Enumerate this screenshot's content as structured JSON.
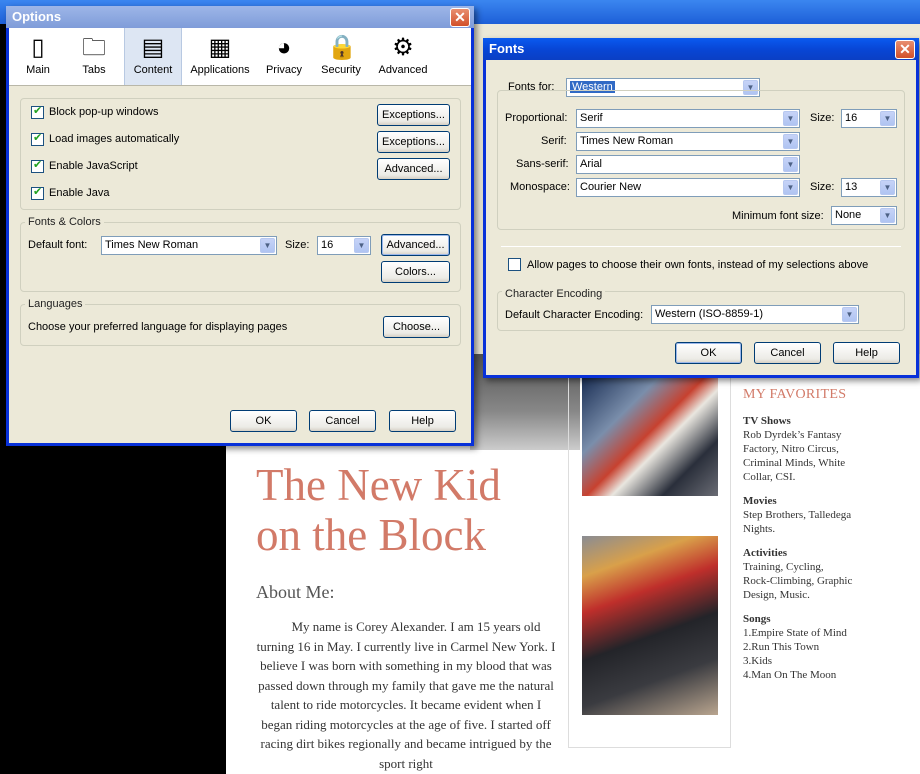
{
  "options_dialog": {
    "title": "Options",
    "tabs": [
      {
        "label": "Main",
        "icon": "main-icon"
      },
      {
        "label": "Tabs",
        "icon": "tabs-icon"
      },
      {
        "label": "Content",
        "icon": "content-icon"
      },
      {
        "label": "Applications",
        "icon": "applications-icon"
      },
      {
        "label": "Privacy",
        "icon": "privacy-icon"
      },
      {
        "label": "Security",
        "icon": "security-icon"
      },
      {
        "label": "Advanced",
        "icon": "advanced-icon"
      }
    ],
    "active_tab": "Content",
    "block_popups": "Block pop-up windows",
    "load_images": "Load images automatically",
    "enable_js": "Enable JavaScript",
    "enable_java": "Enable Java",
    "exceptions_label": "Exceptions...",
    "advanced_label": "Advanced...",
    "fonts_colors_title": "Fonts & Colors",
    "default_font_label": "Default font:",
    "default_font_value": "Times New Roman",
    "size_label": "Size:",
    "size_value": "16",
    "colors_label": "Colors...",
    "languages_title": "Languages",
    "languages_text": "Choose your preferred language for displaying pages",
    "choose_label": "Choose...",
    "ok": "OK",
    "cancel": "Cancel",
    "help": "Help"
  },
  "fonts_dialog": {
    "title": "Fonts",
    "fonts_for_label": "Fonts for:",
    "fonts_for_value": "Western",
    "proportional_label": "Proportional:",
    "proportional_value": "Serif",
    "size_label": "Size:",
    "proportional_size": "16",
    "serif_label": "Serif:",
    "serif_value": "Times New Roman",
    "sans_label": "Sans-serif:",
    "sans_value": "Arial",
    "mono_label": "Monospace:",
    "mono_value": "Courier New",
    "mono_size": "13",
    "min_size_label": "Minimum font size:",
    "min_size_value": "None",
    "allow_pages_label": "Allow pages to choose their own fonts, instead of my selections above",
    "encoding_title": "Character Encoding",
    "encoding_label": "Default Character Encoding:",
    "encoding_value": "Western (ISO-8859-1)",
    "ok": "OK",
    "cancel": "Cancel",
    "help": "Help"
  },
  "page": {
    "title_line1": "The New Kid",
    "title_line2": "on the Block",
    "about_heading": "About Me:",
    "about_text": "My name is Corey Alexander.  I am 15 years old turning 16 in May. I currently live in Carmel New York. I believe I was born with something in my blood that was passed down through my family that gave me the natural talent to ride motorcycles. It became evident when I began riding motorcycles at the age of five. I started off racing dirt bikes regionally and became intrigued by the sport right",
    "favorites_title": "MY FAVORITES",
    "tv_heading": "TV Shows",
    "tv_lines": [
      "Rob Dyrdek’s Fantasy",
      "Factory, Nitro Circus,",
      "Criminal Minds, White",
      "Collar, CSI."
    ],
    "movies_heading": "Movies",
    "movies_lines": [
      "Step Brothers, Talledega",
      "Nights."
    ],
    "activities_heading": "Activities",
    "activities_lines": [
      "Training, Cycling,",
      "Rock-Climbing, Graphic",
      "Design, Music."
    ],
    "songs_heading": "Songs",
    "songs_lines": [
      "1.Empire State of Mind",
      "2.Run This Town",
      "3.Kids",
      "4.Man On The Moon"
    ]
  }
}
